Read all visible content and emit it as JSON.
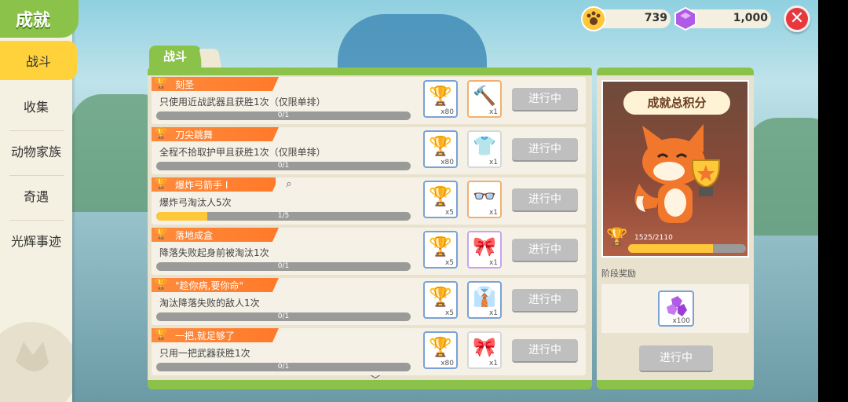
{
  "sidebar": {
    "title": "成就",
    "active": "战斗",
    "items": [
      "收集",
      "动物家族",
      "奇遇",
      "光辉事迹"
    ]
  },
  "topbar": {
    "paw_value": "739",
    "gem_value": "1,000"
  },
  "panel": {
    "tab": "战斗",
    "status_label": "进行中"
  },
  "rows": [
    {
      "title": "刻圣",
      "desc": "只使用近战武器且获胜1次（仅限单排）",
      "progress": "0/1",
      "progress_fraction": 0,
      "rewards": [
        {
          "icon": "trophy-icon",
          "qty": "x80",
          "frame": "blue"
        },
        {
          "icon": "hammer-icon",
          "qty": "x1",
          "frame": "orange"
        }
      ]
    },
    {
      "title": "刀尖跳舞",
      "desc": "全程不拾取护甲且获胜1次（仅限单排）",
      "progress": "0/1",
      "progress_fraction": 0,
      "rewards": [
        {
          "icon": "trophy-icon",
          "qty": "x80",
          "frame": "blue"
        },
        {
          "icon": "shirt-icon",
          "qty": "x1",
          "frame": "gray"
        }
      ]
    },
    {
      "title": "爆炸弓箭手 I",
      "desc": "爆炸弓淘汰人5次",
      "progress": "1/5",
      "progress_fraction": 0.2,
      "rewards": [
        {
          "icon": "trophy-icon",
          "qty": "x5",
          "frame": "blue"
        },
        {
          "icon": "glasses-icon",
          "qty": "x1",
          "frame": "orange"
        }
      ]
    },
    {
      "title": "落地成盒",
      "desc": "降落失败起身前被淘汰1次",
      "progress": "0/1",
      "progress_fraction": 0,
      "rewards": [
        {
          "icon": "trophy-icon",
          "qty": "x5",
          "frame": "blue"
        },
        {
          "icon": "bowtie-icon",
          "qty": "x1",
          "frame": "purple"
        }
      ]
    },
    {
      "title": "\"趁你病,要你命\"",
      "desc": "淘汰降落失败的敌人1次",
      "progress": "0/1",
      "progress_fraction": 0,
      "rewards": [
        {
          "icon": "trophy-icon",
          "qty": "x5",
          "frame": "blue"
        },
        {
          "icon": "necktie-icon",
          "qty": "x1",
          "frame": "blue"
        }
      ]
    },
    {
      "title": "一把,就足够了",
      "desc": "只用一把武器获胜1次",
      "progress": "0/1",
      "progress_fraction": 0,
      "rewards": [
        {
          "icon": "trophy-icon",
          "qty": "x80",
          "frame": "blue"
        },
        {
          "icon": "bow-icon",
          "qty": "x1",
          "frame": "gray"
        }
      ]
    }
  ],
  "right_panel": {
    "title": "成就总积分",
    "score": "1525/2110",
    "score_fraction": 0.72,
    "stage_label": "阶段奖励",
    "reward_qty": "x100",
    "button": "进行中"
  },
  "colors": {
    "accent_green": "#8bc34a",
    "ribbon_orange": "#ff7a2a",
    "progress_yellow": "#ffc83a"
  }
}
